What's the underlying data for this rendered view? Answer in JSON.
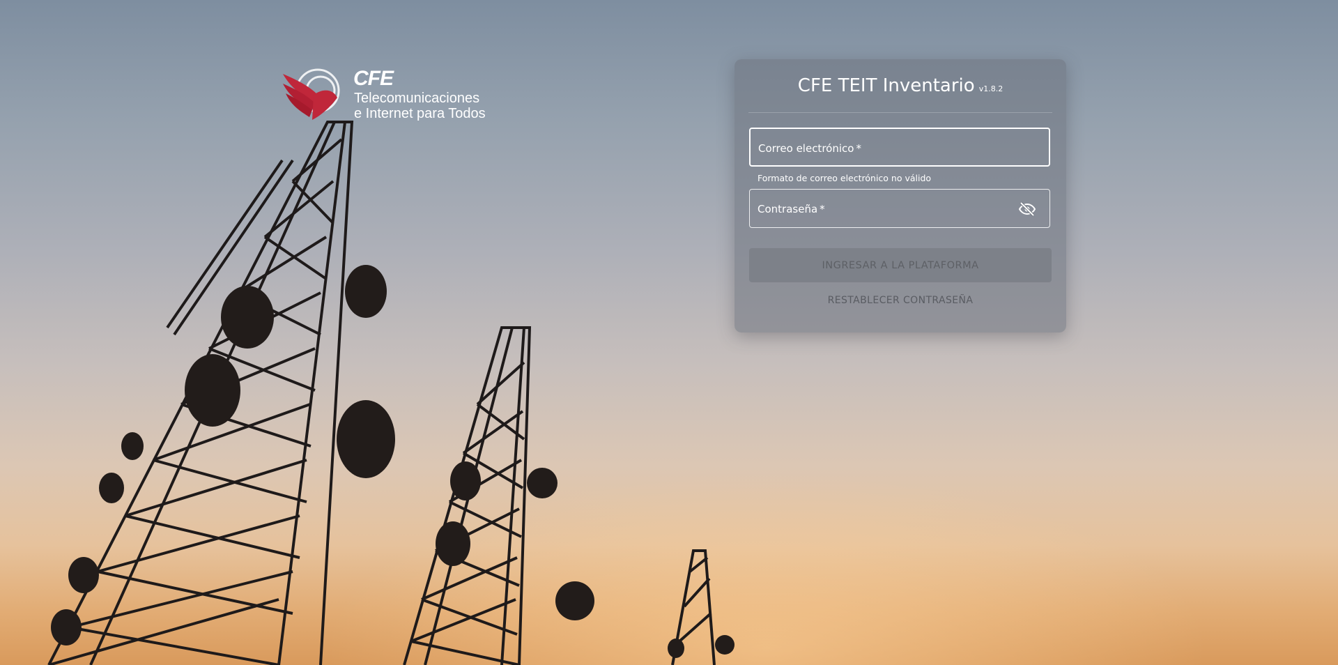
{
  "logo": {
    "brand": "CFE",
    "line1": "Telecomunicaciones",
    "line2": "e Internet para Todos"
  },
  "login": {
    "title": "CFE TEIT Inventario",
    "version": "v1.8.2",
    "email": {
      "label": "Correo electrónico",
      "required_mark": "*",
      "value": "",
      "error": "Formato de correo electrónico no válido"
    },
    "password": {
      "label": "Contraseña",
      "required_mark": "*",
      "value": "",
      "toggle_icon": "eye-off-icon"
    },
    "submit_label": "INGRESAR A LA PLATAFORMA",
    "reset_label": "RESTABLECER CONTRASEÑA"
  },
  "colors": {
    "logo_red": "#c0273a",
    "card_bg": "#6e737d",
    "text": "#ffffff"
  }
}
